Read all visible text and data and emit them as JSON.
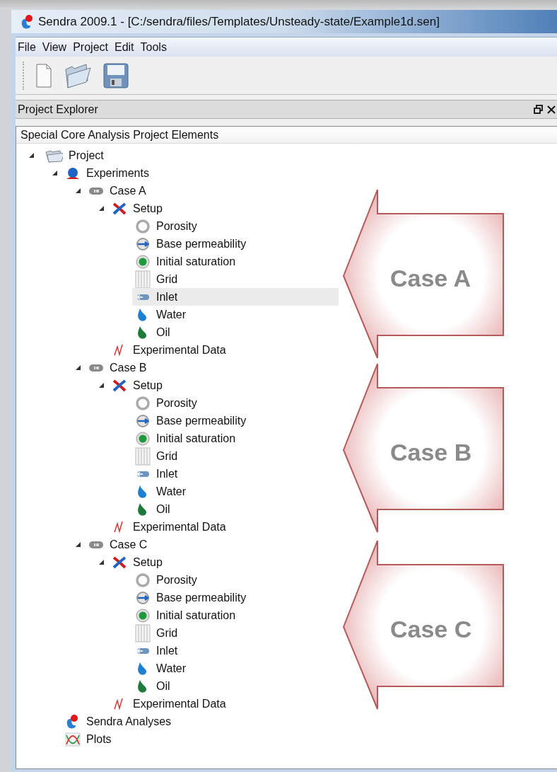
{
  "window": {
    "title": "Sendra 2009.1 - [C:/sendra/files/Templates/Unsteady-state/Example1d.sen]"
  },
  "menu": [
    "File",
    "View",
    "Project",
    "Edit",
    "Tools"
  ],
  "toolbar": [
    {
      "kind": "new"
    },
    {
      "kind": "open"
    },
    {
      "kind": "save"
    }
  ],
  "panel": {
    "title": "Project Explorer",
    "heading": "Special Core Analysis Project Elements"
  },
  "tree": [
    {
      "label": "Project",
      "kind": "folder",
      "expanded": true,
      "selected": false,
      "children": [
        {
          "label": "Experiments",
          "kind": "experiments",
          "expanded": true,
          "selected": false,
          "children": [
            {
              "label": "Case A",
              "kind": "case",
              "expanded": true,
              "selected": false,
              "children": [
                {
                  "label": "Setup",
                  "kind": "setup",
                  "expanded": true,
                  "selected": false,
                  "children": [
                    {
                      "label": "Porosity",
                      "kind": "porosity",
                      "selected": false
                    },
                    {
                      "label": "Base permeability",
                      "kind": "permeability",
                      "selected": false
                    },
                    {
                      "label": "Initial saturation",
                      "kind": "saturation",
                      "selected": false
                    },
                    {
                      "label": "Grid",
                      "kind": "grid",
                      "selected": false
                    },
                    {
                      "label": "Inlet",
                      "kind": "inlet",
                      "selected": true
                    },
                    {
                      "label": "Water",
                      "kind": "water",
                      "selected": false
                    },
                    {
                      "label": "Oil",
                      "kind": "oil",
                      "selected": false
                    }
                  ]
                },
                {
                  "label": "Experimental Data",
                  "kind": "data",
                  "selected": false
                }
              ]
            },
            {
              "label": "Case B",
              "kind": "case",
              "expanded": true,
              "selected": false,
              "children": [
                {
                  "label": "Setup",
                  "kind": "setup",
                  "expanded": true,
                  "selected": false,
                  "children": [
                    {
                      "label": "Porosity",
                      "kind": "porosity",
                      "selected": false
                    },
                    {
                      "label": "Base permeability",
                      "kind": "permeability",
                      "selected": false
                    },
                    {
                      "label": "Initial saturation",
                      "kind": "saturation",
                      "selected": false
                    },
                    {
                      "label": "Grid",
                      "kind": "grid",
                      "selected": false
                    },
                    {
                      "label": "Inlet",
                      "kind": "inlet",
                      "selected": false
                    },
                    {
                      "label": "Water",
                      "kind": "water",
                      "selected": false
                    },
                    {
                      "label": "Oil",
                      "kind": "oil",
                      "selected": false
                    }
                  ]
                },
                {
                  "label": "Experimental Data",
                  "kind": "data",
                  "selected": false
                }
              ]
            },
            {
              "label": "Case C",
              "kind": "case",
              "expanded": true,
              "selected": false,
              "children": [
                {
                  "label": "Setup",
                  "kind": "setup",
                  "expanded": true,
                  "selected": false,
                  "children": [
                    {
                      "label": "Porosity",
                      "kind": "porosity",
                      "selected": false
                    },
                    {
                      "label": "Base permeability",
                      "kind": "permeability",
                      "selected": false
                    },
                    {
                      "label": "Initial saturation",
                      "kind": "saturation",
                      "selected": false
                    },
                    {
                      "label": "Grid",
                      "kind": "grid",
                      "selected": false
                    },
                    {
                      "label": "Inlet",
                      "kind": "inlet",
                      "selected": false
                    },
                    {
                      "label": "Water",
                      "kind": "water",
                      "selected": false
                    },
                    {
                      "label": "Oil",
                      "kind": "oil",
                      "selected": false
                    }
                  ]
                },
                {
                  "label": "Experimental Data",
                  "kind": "data",
                  "selected": false
                }
              ]
            }
          ]
        },
        {
          "label": "Sendra Analyses",
          "kind": "analyses",
          "selected": false
        },
        {
          "label": "Plots",
          "kind": "plots",
          "selected": false
        }
      ]
    }
  ],
  "callouts": [
    {
      "label": "Case A"
    },
    {
      "label": "Case B"
    },
    {
      "label": "Case C"
    }
  ]
}
